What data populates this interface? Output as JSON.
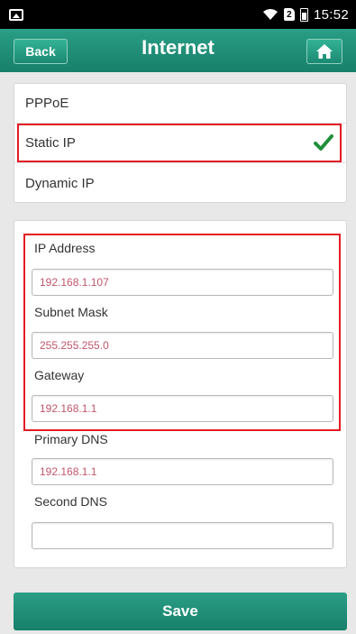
{
  "status_bar": {
    "time": "15:52",
    "icons": [
      "image-icon",
      "wifi-icon",
      "sim-icon",
      "battery-icon"
    ],
    "sim_label": "2"
  },
  "header": {
    "back_label": "Back",
    "title": "Internet",
    "home_icon": "home-icon"
  },
  "connection_modes": {
    "items": [
      {
        "label": "PPPoE",
        "selected": false
      },
      {
        "label": "Static IP",
        "selected": true
      },
      {
        "label": "Dynamic IP",
        "selected": false
      }
    ],
    "check_icon": "checkmark-icon"
  },
  "fields": [
    {
      "label": "IP Address",
      "value": "192.168.1.107"
    },
    {
      "label": "Subnet Mask",
      "value": "255.255.255.0"
    },
    {
      "label": "Gateway",
      "value": "192.168.1.1"
    },
    {
      "label": "Primary DNS",
      "value": "192.168.1.1"
    },
    {
      "label": "Second DNS",
      "value": ""
    }
  ],
  "save_label": "Save",
  "colors": {
    "accent": "#1a8a72",
    "highlight": "#e31b23",
    "input_text": "#c0566b",
    "check": "#1f8f3a"
  }
}
